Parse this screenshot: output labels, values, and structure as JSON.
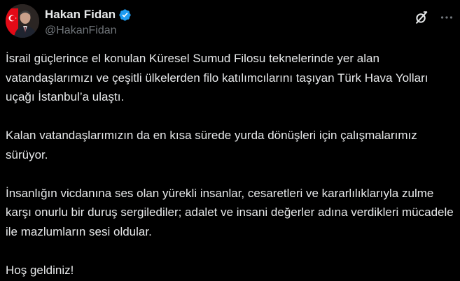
{
  "author": {
    "display_name": "Hakan Fidan",
    "handle": "@HakanFidan",
    "verified": true,
    "avatar_icon": "profile-photo-with-turkish-flag"
  },
  "actions": {
    "grok_icon": "grok-slash-circle-icon",
    "more_icon": "more-horizontal-icon"
  },
  "tweet": {
    "paragraphs": [
      "İsrail güçlerince el konulan Küresel Sumud Filosu teknelerinde yer alan vatandaşlarımızı ve çeşitli ülkelerden filo katılımcılarını taşıyan Türk Hava Yolları uçağı İstanbul’a ulaştı.",
      "Kalan vatandaşlarımızın da en kısa sürede yurda dönüşleri için çalışmalarımız sürüyor.",
      "İnsanlığın vicdanına ses olan yürekli insanlar, cesaretleri ve kararlılıklarıyla zulme karşı onurlu bir duruş sergilediler; adalet ve insani değerler adına verdikleri mücadele ile mazlumların sesi oldular.",
      "Hoş geldiniz!"
    ]
  },
  "colors": {
    "background": "#000000",
    "text_primary": "#e7e9ea",
    "text_secondary": "#71767b",
    "verified_badge": "#1d9bf0",
    "flag_red": "#e30a17"
  }
}
